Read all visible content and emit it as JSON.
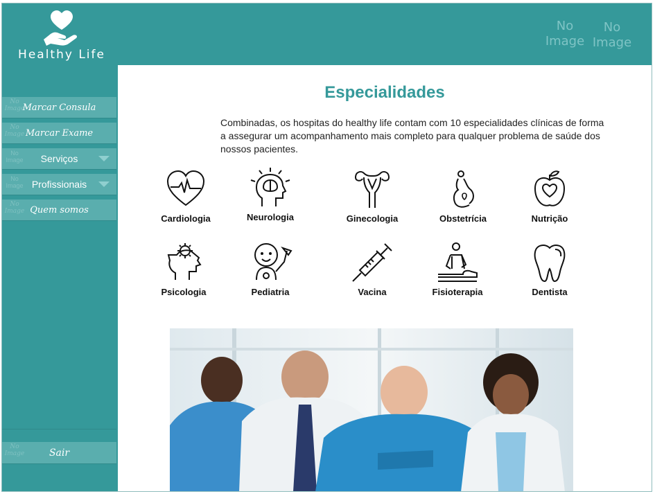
{
  "brand": {
    "name": "Healthy Life"
  },
  "header": {
    "placeholders": [
      "No Image",
      "No Image"
    ]
  },
  "sidebar": {
    "items": [
      {
        "label": "Marcar Consula",
        "icon": "No Image",
        "style": "script"
      },
      {
        "label": "Marcar Exame",
        "icon": "No Image",
        "style": "script"
      },
      {
        "label": "Serviços",
        "icon": "No Image",
        "dropdown": true
      },
      {
        "label": "Profissionais",
        "icon": "No Image",
        "dropdown": true
      },
      {
        "label": "Quem somos",
        "icon": "No Image",
        "style": "script"
      }
    ],
    "logout": {
      "label": "Sair",
      "icon": "No Image"
    }
  },
  "main": {
    "title": "Especialidades",
    "description": "Combinadas, os hospitas do healthy life  contam com 10 especialidades clínicas de forma a assegurar um acompanhamento mais completo para qualquer problema de saúde dos nossos pacientes.",
    "specialties": [
      {
        "name": "Cardiologia",
        "icon": "heart-pulse-icon"
      },
      {
        "name": "Neurologia",
        "icon": "brain-head-icon"
      },
      {
        "name": "Ginecologia",
        "icon": "uterus-icon"
      },
      {
        "name": "Obstetrícia",
        "icon": "pregnant-icon"
      },
      {
        "name": "Nutrição",
        "icon": "apple-icon"
      },
      {
        "name": "Psicologia",
        "icon": "head-gear-icon"
      },
      {
        "name": "Pediatria",
        "icon": "baby-icon"
      },
      {
        "name": "Vacina",
        "icon": "syringe-icon"
      },
      {
        "name": "Fisioterapia",
        "icon": "physiotherapy-icon"
      },
      {
        "name": "Dentista",
        "icon": "tooth-icon"
      }
    ],
    "photo": "medical-team-photo"
  },
  "colors": {
    "primary": "#35999a",
    "menu": "#5aaeae",
    "title": "#35999a"
  }
}
